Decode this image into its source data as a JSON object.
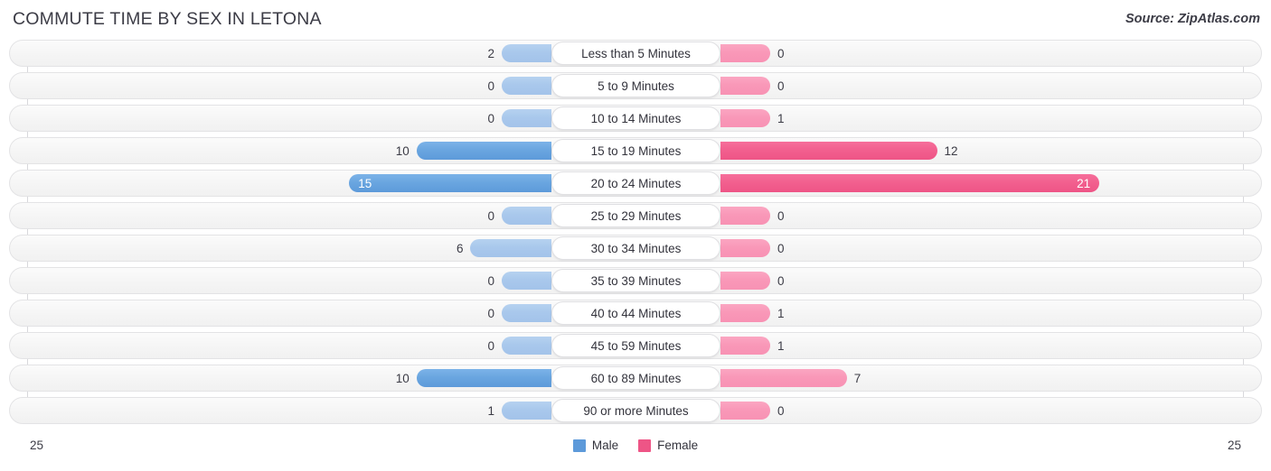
{
  "header": {
    "title": "COMMUTE TIME BY SEX IN LETONA",
    "source": "Source: ZipAtlas.com"
  },
  "axis": {
    "left_label": "25",
    "right_label": "25",
    "max": 25
  },
  "legend": {
    "items": [
      {
        "label": "Male",
        "color": "#5d9ada"
      },
      {
        "label": "Female",
        "color": "#ee5586"
      }
    ]
  },
  "colors": {
    "male_strong": "#5d9ada",
    "male_light": "#a3c3ea",
    "female_strong": "#ee5586",
    "female_light": "#f892b4",
    "row_background": "#f5f5f5",
    "row_border": "#e3e3e5",
    "text": "#3c3c46"
  },
  "chart_data": {
    "type": "bar",
    "title": "COMMUTE TIME BY SEX IN LETONA",
    "subtitle": "Source: ZipAtlas.com",
    "orientation": "horizontal-diverging",
    "xlabel": "",
    "ylabel": "",
    "xlim": [
      -25,
      25
    ],
    "grid": true,
    "legend_position": "bottom-center",
    "categories": [
      "Less than 5 Minutes",
      "5 to 9 Minutes",
      "10 to 14 Minutes",
      "15 to 19 Minutes",
      "20 to 24 Minutes",
      "25 to 29 Minutes",
      "30 to 34 Minutes",
      "35 to 39 Minutes",
      "40 to 44 Minutes",
      "45 to 59 Minutes",
      "60 to 89 Minutes",
      "90 or more Minutes"
    ],
    "series": [
      {
        "name": "Male",
        "values": [
          2,
          0,
          0,
          10,
          15,
          0,
          6,
          0,
          0,
          0,
          10,
          1
        ]
      },
      {
        "name": "Female",
        "values": [
          0,
          0,
          1,
          12,
          21,
          0,
          0,
          0,
          1,
          1,
          7,
          0
        ]
      }
    ]
  },
  "rows": [
    {
      "label": "Less than 5 Minutes",
      "male": "2",
      "female": "0"
    },
    {
      "label": "5 to 9 Minutes",
      "male": "0",
      "female": "0"
    },
    {
      "label": "10 to 14 Minutes",
      "male": "0",
      "female": "1"
    },
    {
      "label": "15 to 19 Minutes",
      "male": "10",
      "female": "12"
    },
    {
      "label": "20 to 24 Minutes",
      "male": "15",
      "female": "21"
    },
    {
      "label": "25 to 29 Minutes",
      "male": "0",
      "female": "0"
    },
    {
      "label": "30 to 34 Minutes",
      "male": "6",
      "female": "0"
    },
    {
      "label": "35 to 39 Minutes",
      "male": "0",
      "female": "0"
    },
    {
      "label": "40 to 44 Minutes",
      "male": "0",
      "female": "1"
    },
    {
      "label": "45 to 59 Minutes",
      "male": "0",
      "female": "1"
    },
    {
      "label": "60 to 89 Minutes",
      "male": "10",
      "female": "7"
    },
    {
      "label": "90 or more Minutes",
      "male": "1",
      "female": "0"
    }
  ]
}
